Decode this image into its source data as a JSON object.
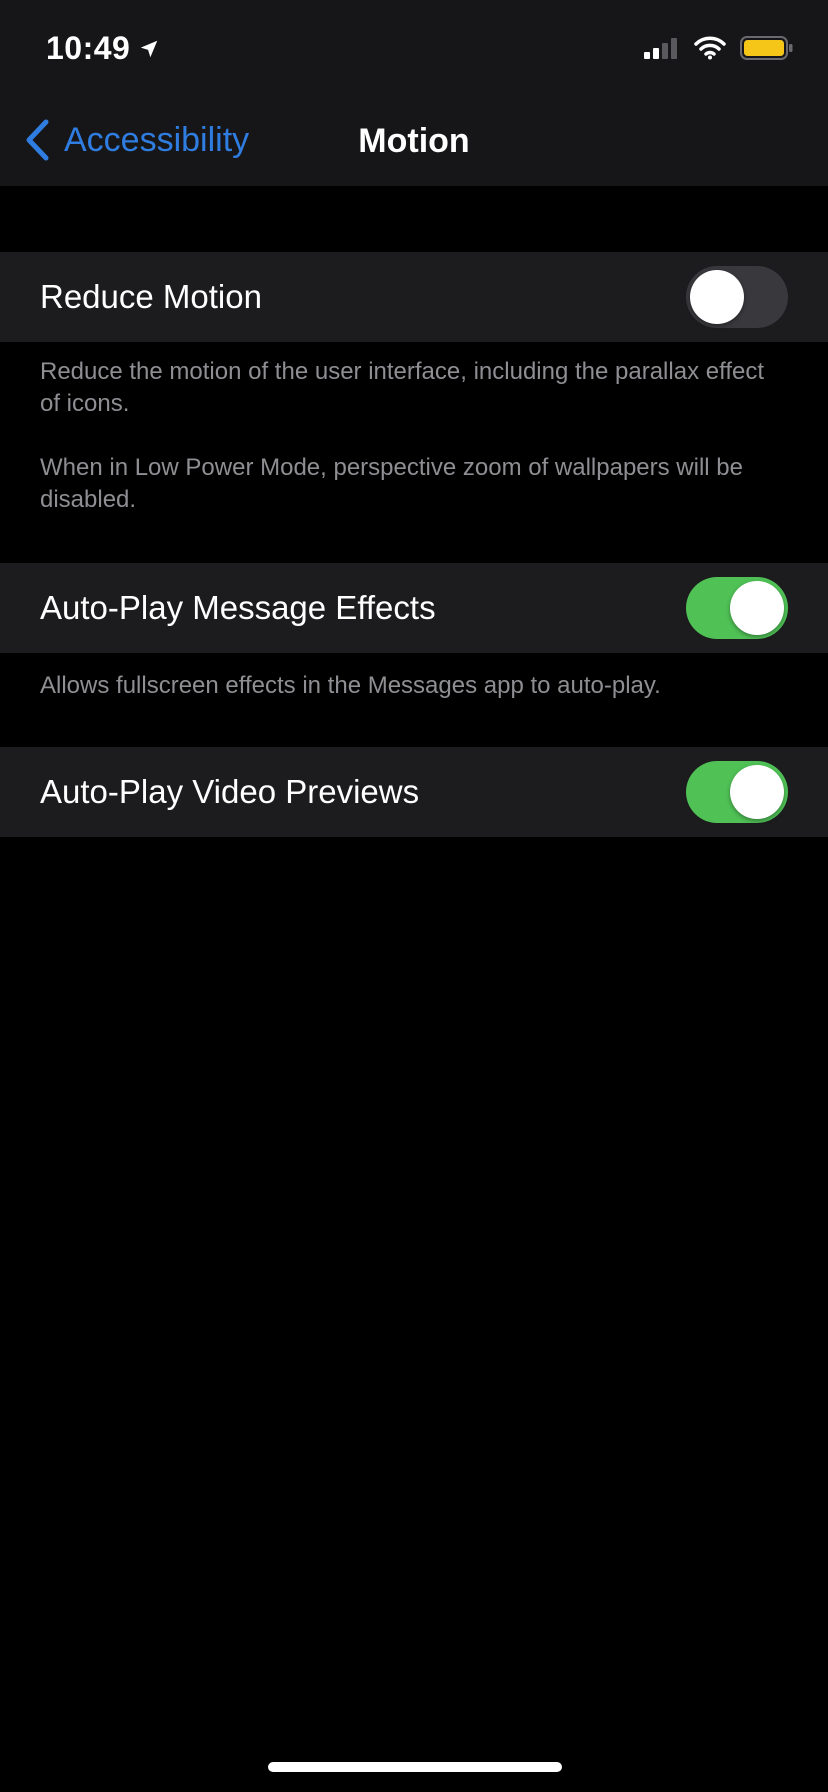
{
  "status_bar": {
    "time": "10:49",
    "icons": [
      "location-arrow-icon",
      "signal-icon",
      "wifi-icon",
      "battery-icon"
    ]
  },
  "nav": {
    "back_label": "Accessibility",
    "title": "Motion",
    "accent_color": "#2f7de1"
  },
  "settings": {
    "reduce_motion": {
      "label": "Reduce Motion",
      "enabled": false,
      "footer_1": "Reduce the motion of the user interface, including the parallax effect of icons.",
      "footer_2": "When in Low Power Mode, perspective zoom of wallpapers will be disabled."
    },
    "message_effects": {
      "label": "Auto-Play Message Effects",
      "enabled": true,
      "footer": "Allows fullscreen effects in the Messages app to auto-play."
    },
    "video_previews": {
      "label": "Auto-Play Video Previews",
      "enabled": true
    }
  },
  "colors": {
    "toggle_on": "#4fc155",
    "toggle_off": "#39393d",
    "battery": "#f5c518"
  }
}
